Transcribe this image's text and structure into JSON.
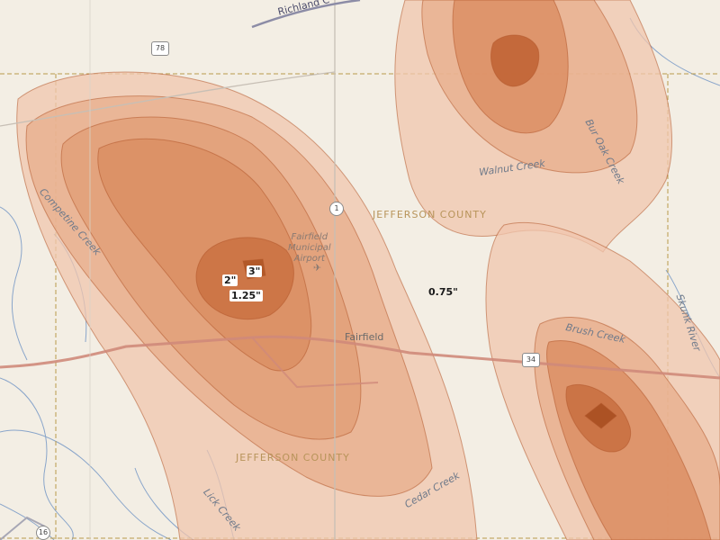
{
  "map": {
    "county_labels": [
      "JEFFERSON COUNTY",
      "JEFFERSON COUNTY"
    ],
    "town": "Fairfield",
    "airport": [
      "Fairfield",
      "Municipal",
      "Airport"
    ],
    "creeks": {
      "richland": "Richland C",
      "competine": "Competine Creek",
      "walnut": "Walnut Creek",
      "bur_oak": "Bur Oak Creek",
      "brush": "Brush Creek",
      "skunk": "Skunk River",
      "lick": "Lick Creek",
      "cedar": "Cedar Creek"
    },
    "route_shields": {
      "r78": "78",
      "r1": "1",
      "r34": "34",
      "r16": "16"
    },
    "precip_labels": {
      "p2": "2\"",
      "p3": "3\"",
      "p125": "1.25\"",
      "p075": "0.75\""
    },
    "colors": {
      "base": "#f3eee4",
      "shade_light": "#f0c6ae",
      "shade_mid": "#dc9266",
      "shade_dark": "#c3683a",
      "contour": "#b2582c",
      "water": "#6f93c4",
      "highway": "#cf8a7a"
    }
  }
}
